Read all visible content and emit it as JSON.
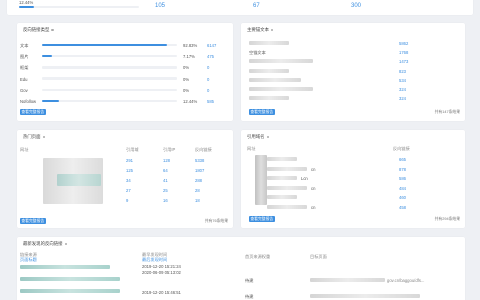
{
  "top_stats": {
    "progress_label": "12.44%",
    "progress_value": 0.1244,
    "values": [
      "105",
      "67",
      "300"
    ]
  },
  "backlink_types": {
    "title": "反向链接类型",
    "rows": [
      {
        "label": "文本",
        "pct": "92.83%",
        "count": "6147",
        "fraction": 0.9283
      },
      {
        "label": "图片",
        "pct": "7.17%",
        "count": "475",
        "fraction": 0.0717
      },
      {
        "label": "框架",
        "pct": "0%",
        "count": "0",
        "fraction": 0
      },
      {
        "label": "Edu",
        "pct": "0%",
        "count": "0",
        "fraction": 0
      },
      {
        "label": "Gov",
        "pct": "0%",
        "count": "0",
        "fraction": 0
      },
      {
        "label": "Nofollow",
        "pct": "12.44%",
        "count": "585",
        "fraction": 0.1244
      }
    ],
    "view_all": "查看完整报告"
  },
  "anchor_text": {
    "title": "主要锚文本",
    "rows": [
      {
        "label": "",
        "count": "5862"
      },
      {
        "label": "空锚文本",
        "count": "1768"
      },
      {
        "label": "",
        "count": "1473"
      },
      {
        "label": "",
        "count": "823"
      },
      {
        "label": "",
        "count": "534"
      },
      {
        "label": "",
        "count": "324"
      },
      {
        "label": "",
        "count": "324"
      }
    ],
    "view_all": "查看完整报告",
    "footer": "共有147条结果"
  },
  "top_pages": {
    "title": "热门页面",
    "headers": [
      "网址",
      "引用域",
      "引用IP",
      "反向链接"
    ],
    "rows": [
      [
        "",
        "291",
        "128",
        "5338"
      ],
      [
        "",
        "125",
        "64",
        "1807"
      ],
      [
        "",
        "34",
        "41",
        "288"
      ],
      [
        "",
        "27",
        "25",
        "28"
      ],
      [
        "",
        "9",
        "16",
        "18"
      ]
    ],
    "view_all": "查看完整报告",
    "footer": "共有76条结果"
  },
  "ref_domains": {
    "title": "引用域名",
    "headers": [
      "网址",
      "反向链接"
    ],
    "rows": [
      {
        "suffix": "",
        "count": "665"
      },
      {
        "suffix": "cn",
        "count": "878"
      },
      {
        "suffix": "Lcn",
        "count": "586"
      },
      {
        "suffix": "cn",
        "count": "484"
      },
      {
        "suffix": "",
        "count": "460"
      },
      {
        "suffix": "cn",
        "count": "458"
      }
    ],
    "view_all": "查看完整报告",
    "footer": "共有294条结果"
  },
  "recent_backlinks": {
    "title": "最新发现的反向链接",
    "headers": [
      "链接来源",
      "最早发现时间",
      "首页来源权重",
      "目标页面"
    ],
    "subheader": "页面标题",
    "subheader2": "最后发现时间",
    "rows": [
      {
        "source": "",
        "first": "2019-12-20 15:21:24",
        "last": "2020-06-09 05:13:02",
        "weight": "待建",
        "target": "gov.cn/baggou/dfs..."
      },
      {
        "source": "",
        "first": "2019-12-20 15:46:51",
        "last": "",
        "weight": "待建",
        "target": ""
      }
    ]
  }
}
